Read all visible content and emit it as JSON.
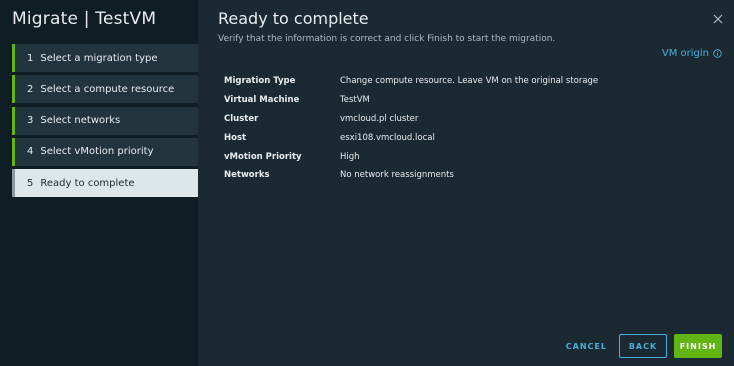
{
  "wizard": {
    "title": "Migrate | TestVM"
  },
  "steps": [
    {
      "num": "1",
      "label": "Select a migration type",
      "state": "done"
    },
    {
      "num": "2",
      "label": "Select a compute resource",
      "state": "done"
    },
    {
      "num": "3",
      "label": "Select networks",
      "state": "done"
    },
    {
      "num": "4",
      "label": "Select vMotion priority",
      "state": "done"
    },
    {
      "num": "5",
      "label": "Ready to complete",
      "state": "active"
    }
  ],
  "main": {
    "title": "Ready to complete",
    "subtitle": "Verify that the information is correct and click Finish to start the migration.",
    "vm_origin_label": "VM origin"
  },
  "details": [
    {
      "label": "Migration Type",
      "value": "Change compute resource. Leave VM on the original storage"
    },
    {
      "label": "Virtual Machine",
      "value": "TestVM"
    },
    {
      "label": "Cluster",
      "value": "vmcloud.pl cluster"
    },
    {
      "label": "Host",
      "value": "esxi108.vmcloud.local"
    },
    {
      "label": "vMotion Priority",
      "value": "High"
    },
    {
      "label": "Networks",
      "value": "No network reassignments"
    }
  ],
  "footer": {
    "cancel_label": "CANCEL",
    "back_label": "BACK",
    "finish_label": "FINISH"
  },
  "icons": {
    "close": "close-icon",
    "info": "info-icon"
  },
  "colors": {
    "accent": "#49afd9",
    "success": "#60b515",
    "sidebar_bg": "#0f1d24",
    "main_bg": "#1b2a32"
  }
}
